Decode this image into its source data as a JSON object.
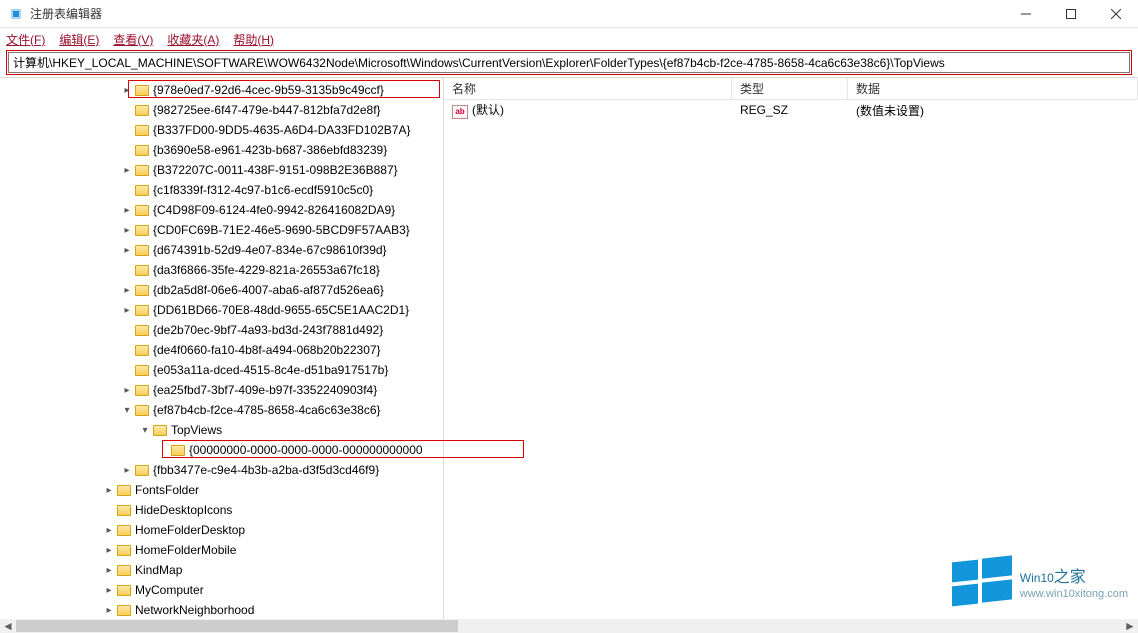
{
  "window": {
    "title": "注册表编辑器"
  },
  "menu": {
    "file": "文件(F)",
    "edit": "编辑(E)",
    "view": "查看(V)",
    "fav": "收藏夹(A)",
    "help": "帮助(H)"
  },
  "addressbar": {
    "path": "计算机\\HKEY_LOCAL_MACHINE\\SOFTWARE\\WOW6432Node\\Microsoft\\Windows\\CurrentVersion\\Explorer\\FolderTypes\\{ef87b4cb-f2ce-4785-8658-4ca6c63e38c6}\\TopViews"
  },
  "tree": {
    "items": [
      {
        "indent": "ind1",
        "twisty": ">",
        "label": "{978e0ed7-92d6-4cec-9b59-3135b9c49ccf}",
        "highlight": false,
        "partialHighlight": true
      },
      {
        "indent": "ind1",
        "twisty": "",
        "label": "{982725ee-6f47-479e-b447-812bfa7d2e8f}"
      },
      {
        "indent": "ind1",
        "twisty": "",
        "label": "{B337FD00-9DD5-4635-A6D4-DA33FD102B7A}"
      },
      {
        "indent": "ind1",
        "twisty": "",
        "label": "{b3690e58-e961-423b-b687-386ebfd83239}"
      },
      {
        "indent": "ind1",
        "twisty": ">",
        "label": "{B372207C-0011-438F-9151-098B2E36B887}"
      },
      {
        "indent": "ind1",
        "twisty": "",
        "label": "{c1f8339f-f312-4c97-b1c6-ecdf5910c5c0}"
      },
      {
        "indent": "ind1",
        "twisty": ">",
        "label": "{C4D98F09-6124-4fe0-9942-826416082DA9}"
      },
      {
        "indent": "ind1",
        "twisty": ">",
        "label": "{CD0FC69B-71E2-46e5-9690-5BCD9F57AAB3}"
      },
      {
        "indent": "ind1",
        "twisty": ">",
        "label": "{d674391b-52d9-4e07-834e-67c98610f39d}"
      },
      {
        "indent": "ind1",
        "twisty": "",
        "label": "{da3f6866-35fe-4229-821a-26553a67fc18}"
      },
      {
        "indent": "ind1",
        "twisty": ">",
        "label": "{db2a5d8f-06e6-4007-aba6-af877d526ea6}"
      },
      {
        "indent": "ind1",
        "twisty": ">",
        "label": "{DD61BD66-70E8-48dd-9655-65C5E1AAC2D1}"
      },
      {
        "indent": "ind1",
        "twisty": "",
        "label": "{de2b70ec-9bf7-4a93-bd3d-243f7881d492}"
      },
      {
        "indent": "ind1",
        "twisty": "",
        "label": "{de4f0660-fa10-4b8f-a494-068b20b22307}"
      },
      {
        "indent": "ind1",
        "twisty": "",
        "label": "{e053a11a-dced-4515-8c4e-d51ba917517b}"
      },
      {
        "indent": "ind1",
        "twisty": ">",
        "label": "{ea25fbd7-3bf7-409e-b97f-3352240903f4}"
      },
      {
        "indent": "ind1",
        "twisty": "v",
        "label": "{ef87b4cb-f2ce-4785-8658-4ca6c63e38c6}"
      },
      {
        "indent": "ind2",
        "twisty": "v",
        "label": "TopViews"
      },
      {
        "indent": "ind3",
        "twisty": "",
        "label": "{00000000-0000-0000-0000-000000000000",
        "highlight": true
      },
      {
        "indent": "ind1",
        "twisty": ">",
        "label": "{fbb3477e-c9e4-4b3b-a2ba-d3f5d3cd46f9}"
      },
      {
        "indent": "ind0",
        "twisty": ">",
        "label": "FontsFolder"
      },
      {
        "indent": "ind0",
        "twisty": "",
        "label": "HideDesktopIcons"
      },
      {
        "indent": "ind0",
        "twisty": ">",
        "label": "HomeFolderDesktop"
      },
      {
        "indent": "ind0",
        "twisty": ">",
        "label": "HomeFolderMobile"
      },
      {
        "indent": "ind0",
        "twisty": ">",
        "label": "KindMap"
      },
      {
        "indent": "ind0",
        "twisty": ">",
        "label": "MyComputer"
      },
      {
        "indent": "ind0",
        "twisty": ">",
        "label": "NetworkNeighborhood"
      }
    ]
  },
  "list": {
    "headers": {
      "name": "名称",
      "type": "类型",
      "data": "数据"
    },
    "rows": [
      {
        "name": "(默认)",
        "type": "REG_SZ",
        "data": "(数值未设置)"
      }
    ]
  },
  "watermark": {
    "line1a": "Win10",
    "line1b": "之家",
    "line2": "www.win10xitong.com"
  }
}
